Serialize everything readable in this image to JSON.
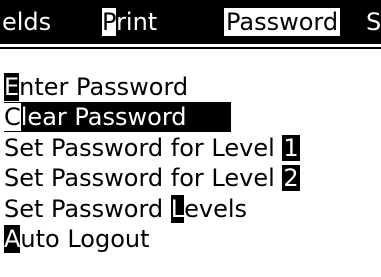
{
  "menubar": {
    "items": [
      {
        "label": "elds",
        "hotkey": "",
        "rest": ""
      },
      {
        "label": "rint",
        "hotkey": "P",
        "rest": ""
      },
      {
        "label": "Password",
        "hotkey": "",
        "rest": ""
      },
      {
        "label": "S",
        "hotkey": "",
        "rest": ""
      }
    ]
  },
  "menu": {
    "items": [
      {
        "first": "E",
        "rest": "nter Password"
      },
      {
        "first": "C",
        "rest": "lear Password"
      },
      {
        "text": "Set Password for Level ",
        "level": "1"
      },
      {
        "text": "Set Password for Level ",
        "level": "2"
      },
      {
        "pre": "Set Password ",
        "hot": "L",
        "post": "evels"
      },
      {
        "first": "A",
        "rest": "uto Logout"
      }
    ]
  }
}
